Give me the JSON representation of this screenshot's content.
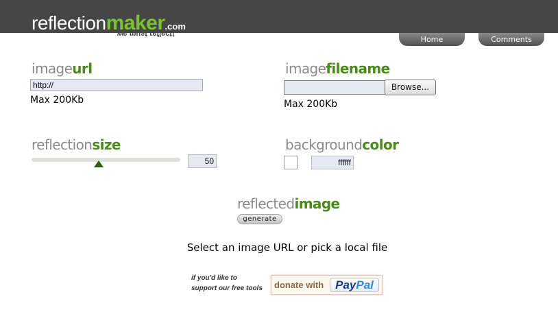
{
  "brand": {
    "logo_part1": "reflection",
    "logo_part2": "maker",
    "logo_part3": ".com",
    "tagline": "we must reflect!",
    "accent_color": "#7ac230",
    "title_color": "#4a8a19"
  },
  "nav": {
    "home": "Home",
    "comments": "Comments"
  },
  "image_url": {
    "title_light": "image",
    "title_bold": "url",
    "value": "http://",
    "note": "Max 200Kb"
  },
  "image_filename": {
    "title_light": "image",
    "title_bold": "filename",
    "value": "",
    "browse_label": "Browse...",
    "note": "Max 200Kb"
  },
  "reflection_size": {
    "title_light": "reflection",
    "title_bold": "size",
    "value": "50",
    "slider_fraction": 0.45
  },
  "background_color": {
    "title_light": "background",
    "title_bold": "color",
    "value": "ffffff",
    "swatch": "#ffffff"
  },
  "reflected_image": {
    "title_light": "reflected",
    "title_bold": "image",
    "generate_label": "generate"
  },
  "status_message": "Select an image URL or pick a local file",
  "support": {
    "line1": "if you'd like to",
    "line2": "support our free tools",
    "donate_text": "donate with",
    "paypal_pay": "Pay",
    "paypal_pal": "Pal"
  },
  "icons": {
    "slider_thumb": "triangle-up-icon",
    "color_swatch": "color-swatch"
  }
}
